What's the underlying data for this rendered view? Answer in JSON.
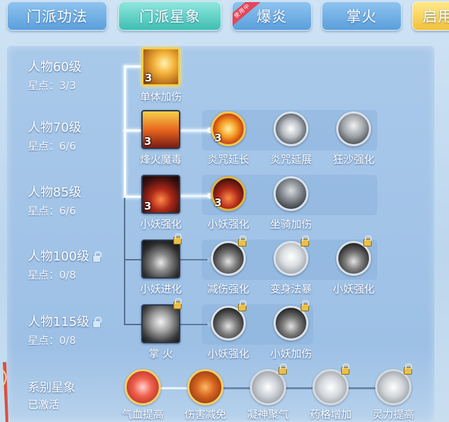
{
  "tabs": [
    {
      "label": "门派功法"
    },
    {
      "label": "门派星象"
    },
    {
      "label": "爆炎",
      "badge": "使用中"
    },
    {
      "label": "掌火"
    },
    {
      "label": "启用"
    }
  ],
  "levels": [
    {
      "title": "人物60级",
      "stars": "星点：3/3",
      "locked": false
    },
    {
      "title": "人物70级",
      "stars": "星点：6/6",
      "locked": false
    },
    {
      "title": "人物85级",
      "stars": "星点：6/6",
      "locked": false
    },
    {
      "title": "人物100级",
      "stars": "星点：0/8",
      "locked": true
    },
    {
      "title": "人物115级",
      "stars": "星点：0/8",
      "locked": true
    }
  ],
  "skills": {
    "r1": [
      {
        "name": "单体加伤",
        "count": "3",
        "icon": "sword-slash-icon",
        "active": true
      }
    ],
    "r2": [
      {
        "name": "烽火魔毒",
        "count": "3",
        "icon": "fire-tower-icon",
        "active": true
      },
      {
        "name": "炎咒延长",
        "count": "3",
        "icon": "flame-rune-icon",
        "active": true
      },
      {
        "name": "炎咒延展",
        "count": "",
        "icon": "rune-wheel-icon",
        "active": false
      },
      {
        "name": "狂沙强化",
        "count": "",
        "icon": "sandstorm-icon",
        "active": false
      }
    ],
    "r3": [
      {
        "name": "小妖强化",
        "count": "3",
        "icon": "demon-flame-icon",
        "active": true
      },
      {
        "name": "小妖强化",
        "count": "3",
        "icon": "demon-flame-icon",
        "active": true
      },
      {
        "name": "坐骑加伤",
        "count": "",
        "icon": "mount-beast-icon",
        "active": false
      }
    ],
    "r4": [
      {
        "name": "小妖进化",
        "count": "",
        "icon": "demon-evolve-icon",
        "locked": true
      },
      {
        "name": "减伤强化",
        "count": "",
        "icon": "demon-shield-icon",
        "locked": true
      },
      {
        "name": "变身法暴",
        "count": "",
        "icon": "transform-hands-icon",
        "locked": true
      },
      {
        "name": "小妖强化",
        "count": "",
        "icon": "demon-flame-icon",
        "locked": true
      }
    ],
    "r5": [
      {
        "name": "掌 火",
        "count": "",
        "icon": "beast-mask-icon",
        "locked": true
      },
      {
        "name": "小妖强化",
        "count": "",
        "icon": "demon-flame-icon",
        "locked": true
      },
      {
        "name": "小妖加伤",
        "count": "",
        "icon": "demon-flame-icon",
        "locked": true
      }
    ]
  },
  "system": {
    "title": "系别星象",
    "status": "已激活",
    "nodes": [
      {
        "name": "气血提高",
        "icon": "heart-icon",
        "locked": false
      },
      {
        "name": "伤害减免",
        "icon": "warrior-icon",
        "locked": false
      },
      {
        "name": "凝神聚气",
        "icon": "meditate-icon",
        "locked": true
      },
      {
        "name": "药格增加",
        "icon": "potion-icon",
        "locked": true
      },
      {
        "name": "灵力提高",
        "icon": "spirit-icon",
        "locked": true
      }
    ]
  },
  "colors": {
    "accent_gold": "#f3cf4a",
    "tab_blue": "#5b9fdc",
    "tab_green": "#3fbfb2",
    "badge_red": "#e2475a"
  }
}
